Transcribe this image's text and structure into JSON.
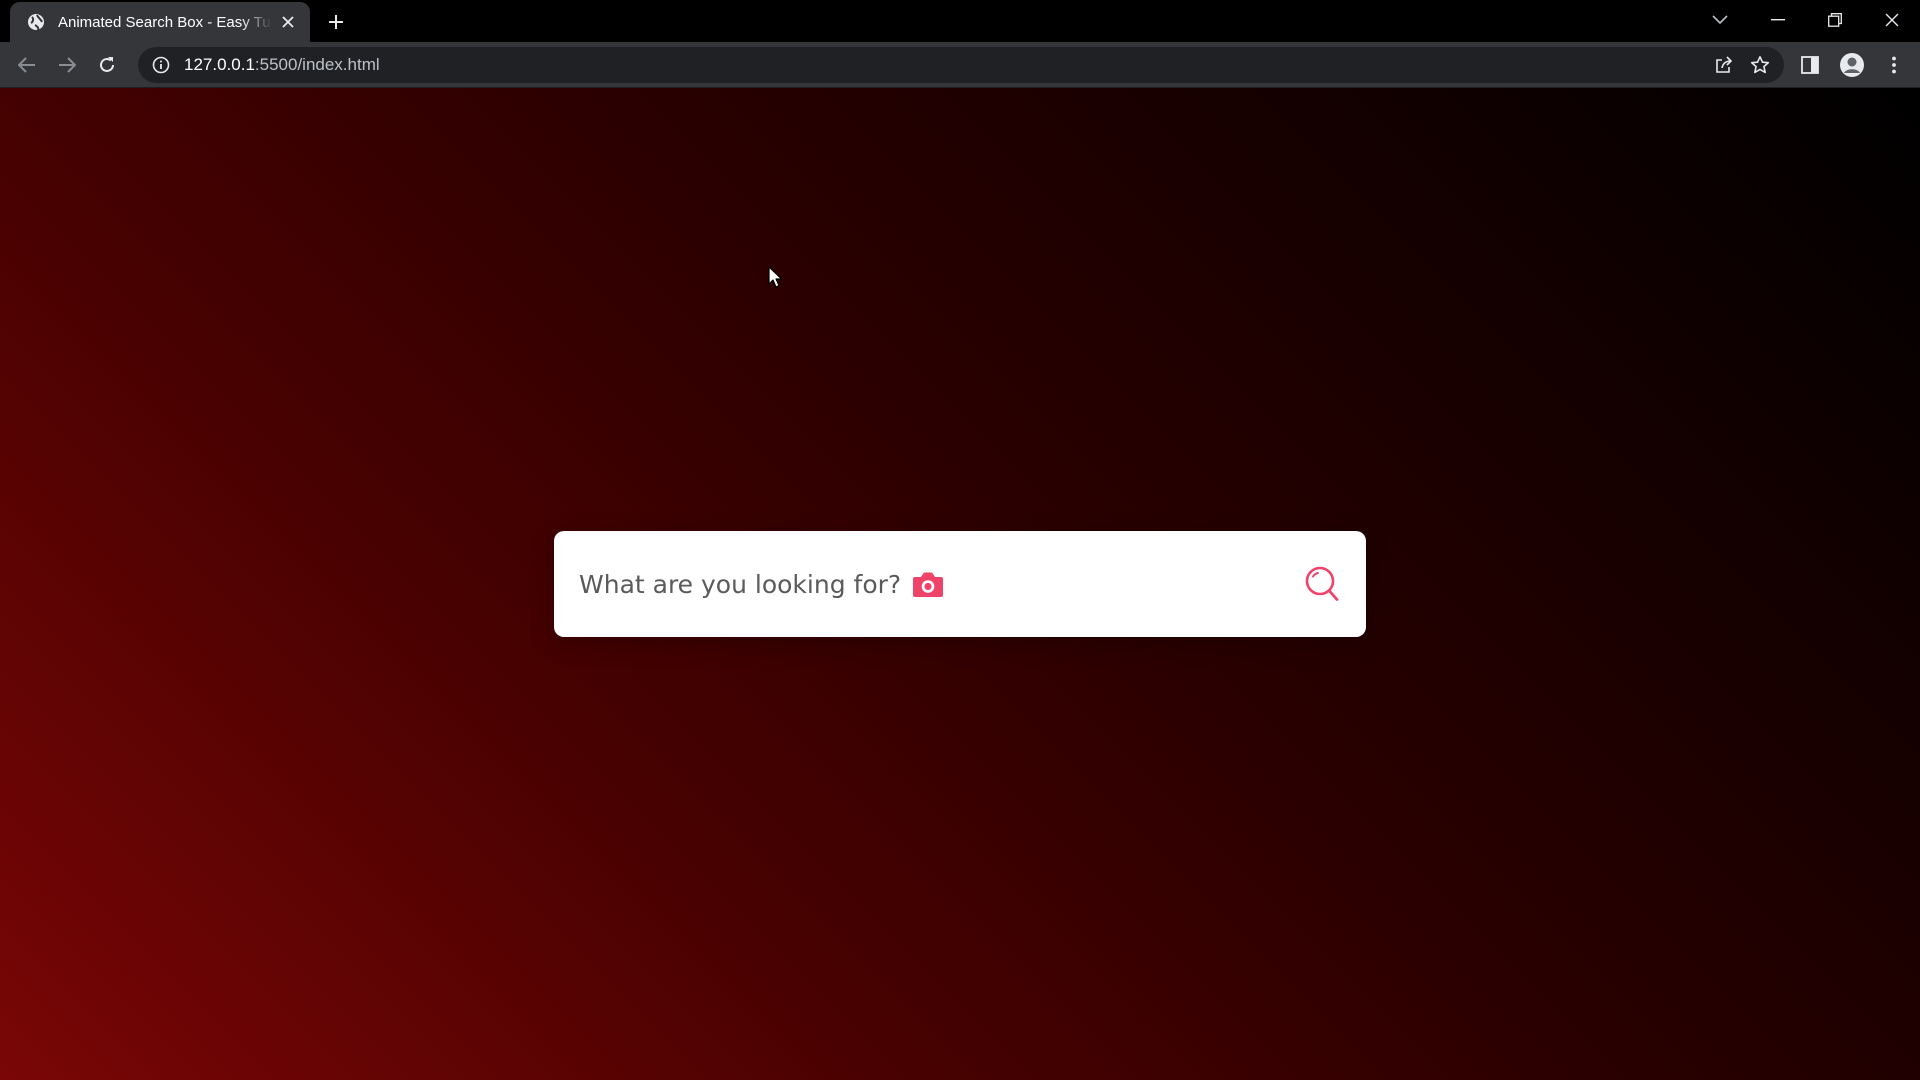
{
  "browser": {
    "tab": {
      "title": "Animated Search Box - Easy Tutorials"
    },
    "address_bar": {
      "url_host": "127.0.0.1",
      "url_rest": ":5500/index.html"
    }
  },
  "page": {
    "search": {
      "placeholder": "What are you looking for?"
    }
  },
  "colors": {
    "accent": "#f0436a",
    "chrome_frame": "#000000",
    "chrome_toolbar": "#35363a",
    "page_gradient_start": "#7a0606",
    "page_gradient_end": "#000000"
  },
  "icons": {
    "tab_favicon": "globe-icon",
    "tab_close": "close-icon",
    "new_tab": "plus-icon",
    "back": "arrow-left-icon",
    "forward": "arrow-right-icon",
    "reload": "reload-icon",
    "site_info": "info-icon",
    "share": "share-icon",
    "bookmark": "star-icon",
    "side_panel": "side-panel-icon",
    "profile": "avatar-icon",
    "menu": "kebab-menu-icon",
    "tab_search": "chevron-down-icon",
    "minimize": "minimize-icon",
    "maximize": "restore-icon",
    "close_window": "close-window-icon",
    "camera": "camera-icon",
    "search": "search-icon"
  }
}
